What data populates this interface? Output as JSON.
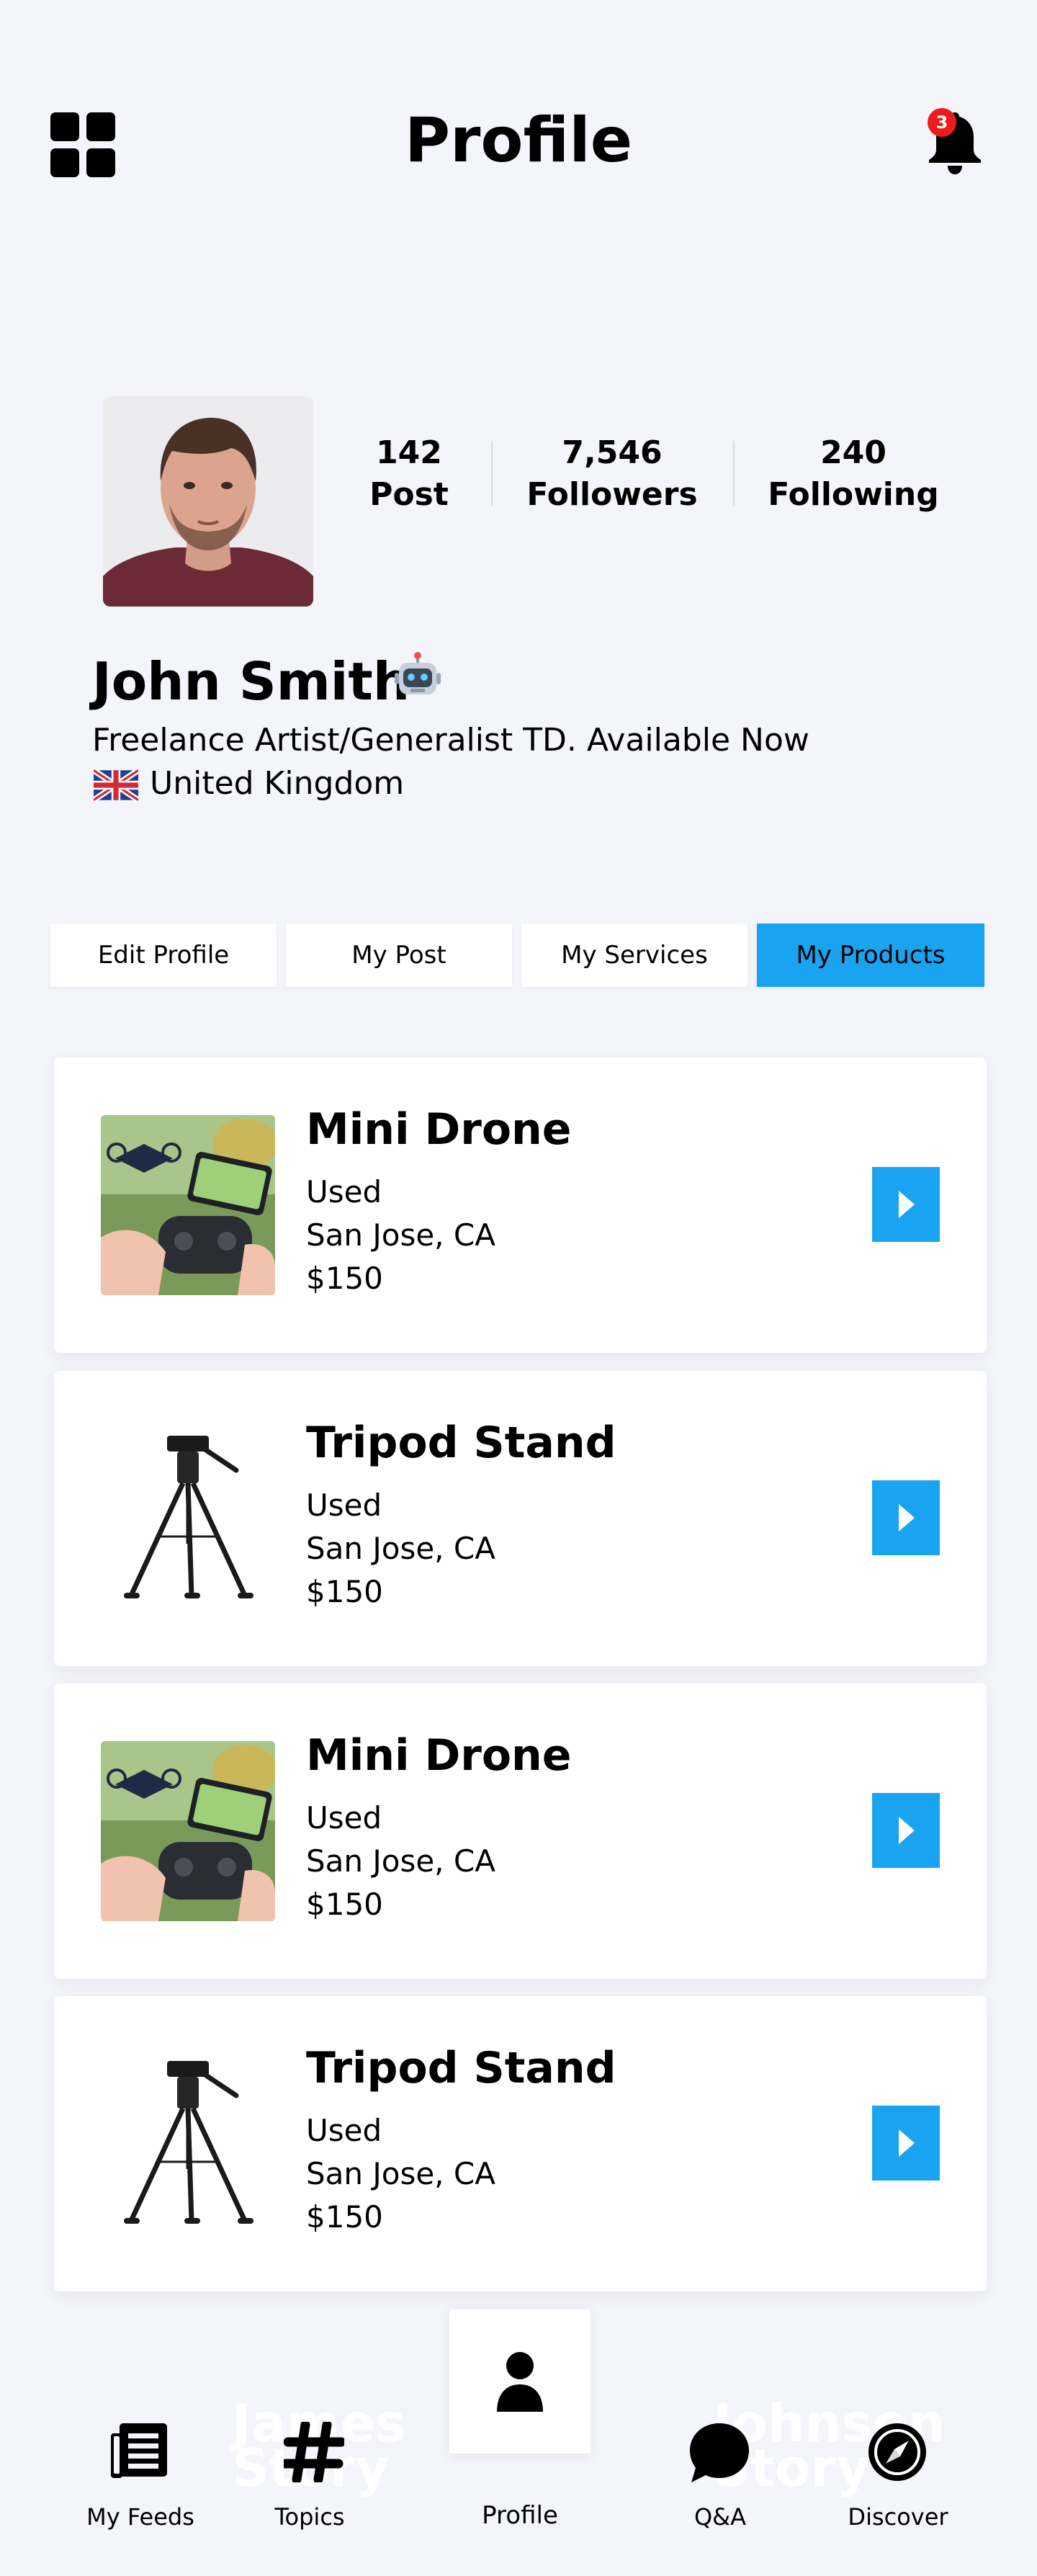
{
  "header": {
    "title": "Profile",
    "notification_count": "3",
    "menu_icon": "grid-icon",
    "bell_icon": "bell-icon"
  },
  "profile": {
    "name": "John Smith",
    "name_emoji": "robot-face-icon",
    "bio": "Freelance Artist/Generalist TD. Available Now",
    "flag": "uk-flag-icon",
    "country": "United Kingdom",
    "stats": [
      {
        "value": "142",
        "label": "Post"
      },
      {
        "value": "7,546",
        "label": "Followers"
      },
      {
        "value": "240",
        "label": "Following"
      }
    ]
  },
  "tabs": [
    {
      "label": "Edit Profile",
      "active": false
    },
    {
      "label": "My Post",
      "active": false
    },
    {
      "label": "My Services",
      "active": false
    },
    {
      "label": "My Products",
      "active": true
    }
  ],
  "products": [
    {
      "title": "Mini Drone",
      "condition": "Used",
      "location": "San Jose, CA",
      "price": "$150",
      "image": "mini-drone-photo"
    },
    {
      "title": "Tripod Stand",
      "condition": "Used",
      "location": "San Jose, CA",
      "price": "$150",
      "image": "tripod-stand-photo"
    },
    {
      "title": "Mini Drone",
      "condition": "Used",
      "location": "San Jose, CA",
      "price": "$150",
      "image": "mini-drone-photo"
    },
    {
      "title": "Tripod Stand",
      "condition": "Used",
      "location": "San Jose, CA",
      "price": "$150",
      "image": "tripod-stand-photo"
    }
  ],
  "bottom_nav": {
    "items": [
      {
        "label": "My Feeds",
        "icon": "feeds-icon"
      },
      {
        "label": "Topics",
        "icon": "hashtag-icon"
      },
      {
        "label": "Profile",
        "icon": "person-icon",
        "active": true
      },
      {
        "label": "Q&A",
        "icon": "chat-bubble-icon"
      },
      {
        "label": "Discover",
        "icon": "compass-icon"
      }
    ],
    "faded_text": [
      "James",
      "Story",
      "Johnson",
      "Story"
    ]
  },
  "colors": {
    "accent": "#1aa3f0",
    "background": "#f4f5fa",
    "badge": "#ee1b1b"
  }
}
